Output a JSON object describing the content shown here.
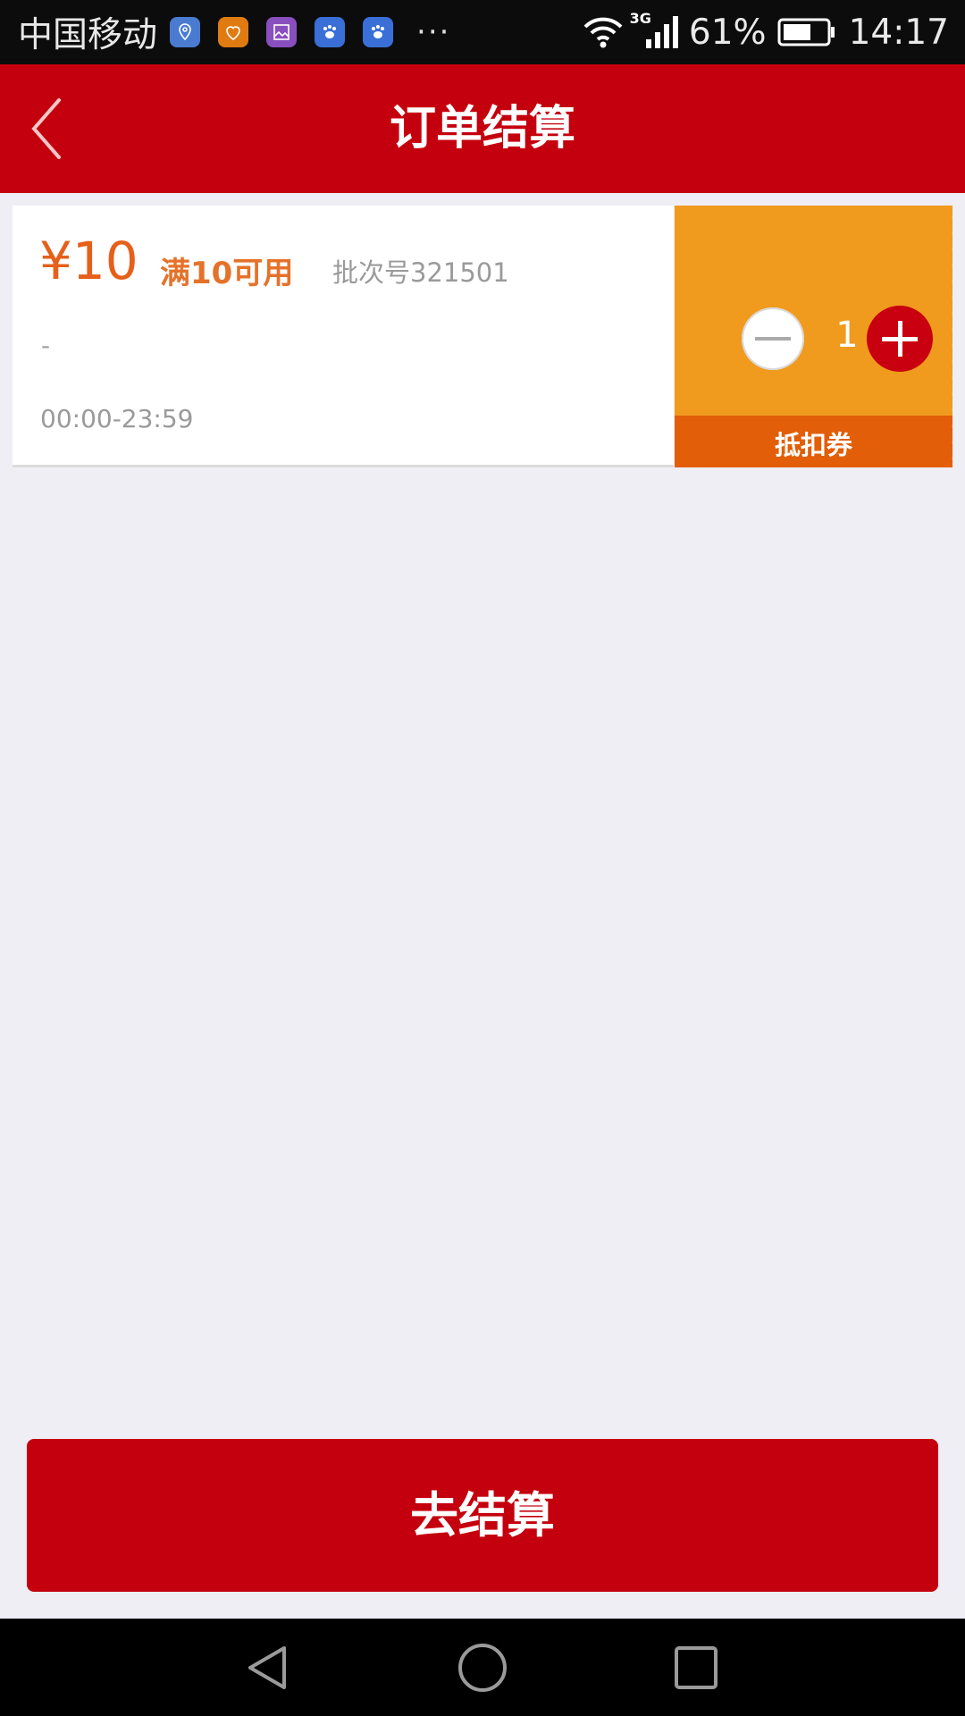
{
  "status_bar": {
    "carrier": "中国移动",
    "app_icons": [
      {
        "name": "location-app-icon",
        "color": "#4a7bd0"
      },
      {
        "name": "health-app-icon",
        "color": "#e07b12"
      },
      {
        "name": "gallery-app-icon",
        "color": "#8a4fbf"
      },
      {
        "name": "baidu-app-icon",
        "color": "#3a6fd8"
      },
      {
        "name": "baidu-app-icon-2",
        "color": "#3a6fd8"
      }
    ],
    "overflow": "···",
    "network_type": "3G",
    "battery_percent": "61%",
    "time": "14:17"
  },
  "header": {
    "title": "订单结算",
    "background": "#c5000e"
  },
  "coupon": {
    "amount": "¥10",
    "condition": "满10可用",
    "batch": "批次号321501",
    "description": "-",
    "valid_time": "00:00-23:59",
    "quantity": "1",
    "type_label": "抵扣券",
    "accent_color": "#f09a1e"
  },
  "checkout": {
    "button_label": "去结算"
  }
}
